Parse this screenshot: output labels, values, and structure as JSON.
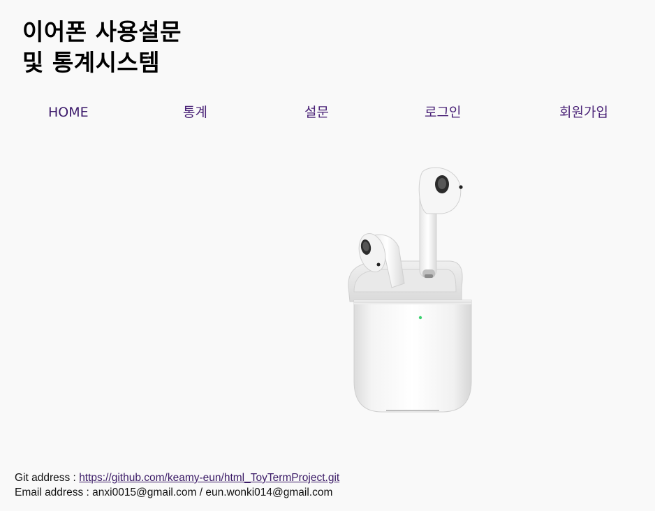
{
  "header": {
    "title_line1": "이어폰 사용설문",
    "title_line2": "및 통계시스템"
  },
  "nav": {
    "items": [
      {
        "label": "HOME"
      },
      {
        "label": "통계"
      },
      {
        "label": "설문"
      },
      {
        "label": "로그인"
      },
      {
        "label": "회원가입"
      }
    ]
  },
  "hero": {
    "image": "airpods-with-case"
  },
  "footer": {
    "git_label": "Git address : ",
    "git_link": "https://github.com/keamy-eun/html_ToyTermProject.git",
    "email_label": "Email address : ",
    "email_value": "anxi0015@gmail.com / eun.wonki014@gmail.com"
  },
  "colors": {
    "background": "#f9f9f9",
    "nav_link": "#4a2277",
    "status_led": "#3bd16f"
  }
}
